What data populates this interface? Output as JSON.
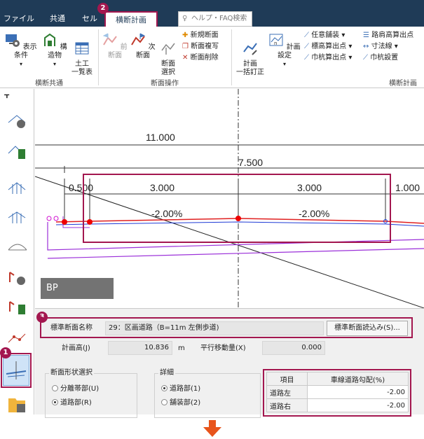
{
  "tabs": [
    {
      "label": "ファイル"
    },
    {
      "label": "共通"
    },
    {
      "label": "セル"
    },
    {
      "label": "横断計画"
    }
  ],
  "help_placeholder": "ヘルプ・FAQ検索",
  "ribbon": {
    "common_group": {
      "label": "横断共通",
      "buttons": [
        {
          "label": "表示条件"
        },
        {
          "label": "構造物"
        },
        {
          "label": "土工\n一覧表"
        }
      ]
    },
    "section_group": {
      "label": "断面操作",
      "buttons": [
        {
          "label": "前断面"
        },
        {
          "label": "次断面"
        },
        {
          "label": "断面\n選択"
        }
      ],
      "small": [
        {
          "label": "新規断面"
        },
        {
          "label": "断面複写"
        },
        {
          "label": "断面削除"
        }
      ]
    },
    "plan_group": {
      "label": "横断計画",
      "buttons": [
        {
          "label": "計画\n一括訂正"
        },
        {
          "label": "計画設定"
        }
      ],
      "small": [
        {
          "label": "任意舗装"
        },
        {
          "label": "標高算出点"
        },
        {
          "label": "巾杭算出点"
        },
        {
          "label": "路肩高算出点"
        },
        {
          "label": "寸法線"
        },
        {
          "label": "巾杭設置"
        }
      ]
    }
  },
  "canvas": {
    "dim_top": "11.000",
    "dim_mid": "7.500",
    "dim_left": "0.500",
    "dim_lane_left": "3.000",
    "dim_lane_right": "3.000",
    "dim_right": "1.000",
    "slope_left": "-2.00%",
    "slope_right": "-2.00%",
    "bp_label": "BP"
  },
  "panel": {
    "std_section_label": "標準断面名称",
    "std_section_value": "29：区画道路（B=11m 左側歩道)",
    "load_button": "標準断面読込み(S)...",
    "plan_height_label": "計画高(J)",
    "plan_height_value": "10.836",
    "plan_height_unit": "m",
    "parallel_label": "平行移動量(X)",
    "parallel_value": "0.000",
    "shape_group": "断面形状選択",
    "shape_options": [
      {
        "label": "分離帯部(U)",
        "selected": false
      },
      {
        "label": "道路部(R)",
        "selected": true
      }
    ],
    "detail_group": "詳細",
    "detail_options": [
      {
        "label": "道路部(1)",
        "selected": true
      },
      {
        "label": "舗装部(2)",
        "selected": false
      }
    ],
    "table_header_item": "項目",
    "table_header_value": "車線道路勾配(%)",
    "rows": [
      {
        "label": "道路左",
        "value": "-2.00"
      },
      {
        "label": "道路右",
        "value": "-2.00"
      }
    ]
  },
  "badges": [
    "1",
    "2",
    "3"
  ],
  "colors": {
    "accent": "#a3174f",
    "tabbar": "#1f3b57",
    "arrow": "#e8541b"
  }
}
